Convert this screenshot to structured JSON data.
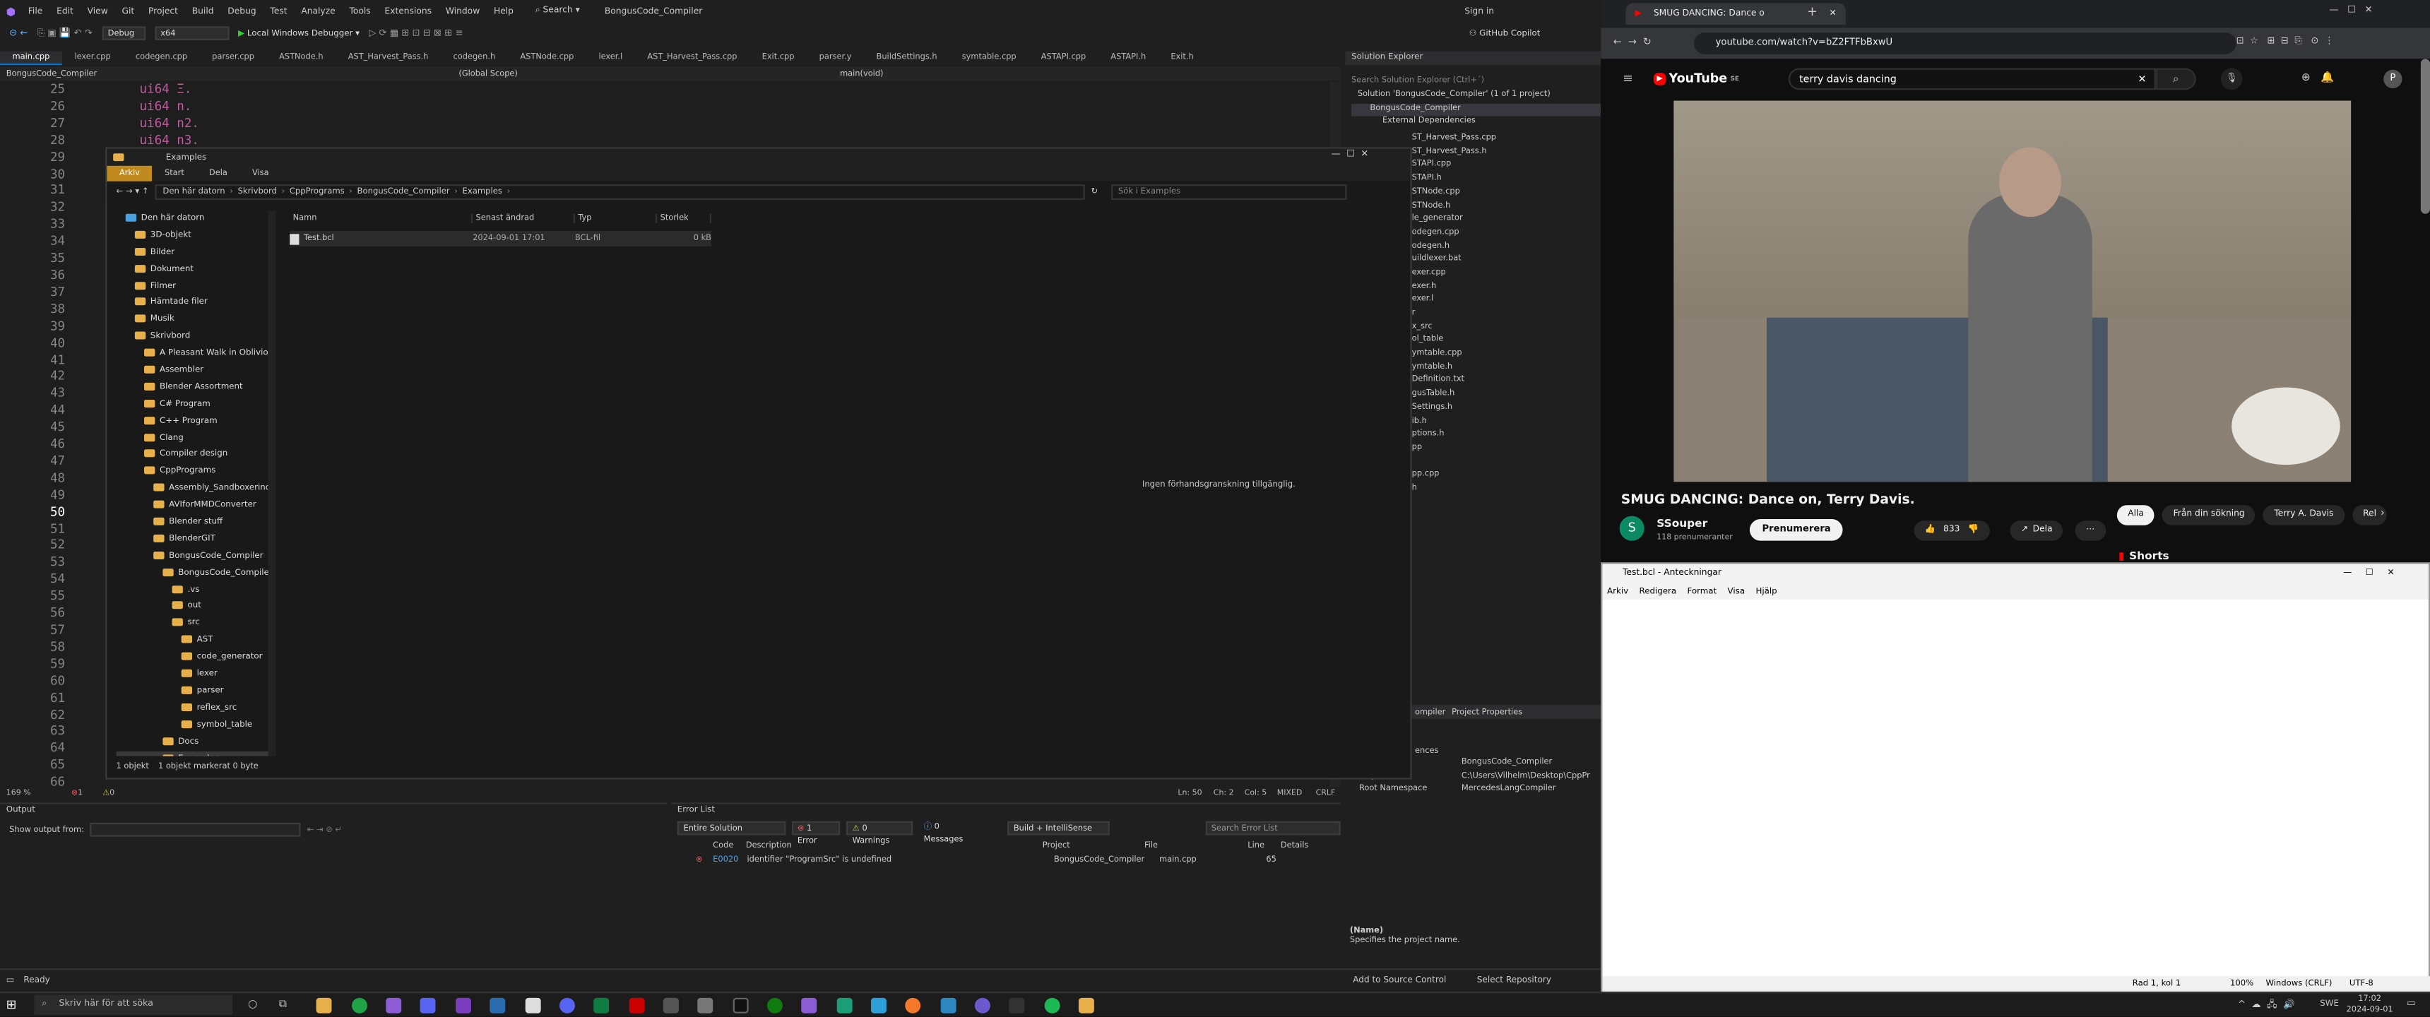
{
  "vs": {
    "menu": [
      "File",
      "Edit",
      "View",
      "Git",
      "Project",
      "Build",
      "Debug",
      "Test",
      "Analyze",
      "Tools",
      "Extensions",
      "Window",
      "Help"
    ],
    "search_label": "Search",
    "solution_title": "BongusCode_Compiler",
    "signin": "Sign in",
    "copilot": "GitHub Copilot",
    "config": "Debug",
    "platform": "x64",
    "debugger": "Local Windows Debugger",
    "tabs": [
      "main.cpp",
      "lexer.cpp",
      "codegen.cpp",
      "parser.cpp",
      "ASTNode.h",
      "AST_Harvest_Pass.h",
      "codegen.h",
      "ASTNode.cpp",
      "lexer.l",
      "AST_Harvest_Pass.cpp",
      "Exit.cpp",
      "parser.y",
      "BuildSettings.h",
      "symtable.cpp",
      "ASTAPI.cpp",
      "ASTAPI.h",
      "Exit.h"
    ],
    "scope_project": "BongusCode_Compiler",
    "scope_global": "(Global Scope)",
    "scope_fn": "main(void)",
    "line_numbers": [
      "25",
      "26",
      "27",
      "28",
      "29",
      "30",
      "31",
      "32",
      "33",
      "34",
      "35",
      "36",
      "37",
      "38",
      "39",
      "40",
      "41",
      "42",
      "43",
      "44",
      "45",
      "46",
      "47",
      "48",
      "49",
      "50",
      "51",
      "52",
      "53",
      "54",
      "55",
      "56",
      "57",
      "58",
      "59",
      "60",
      "61",
      "62",
      "63",
      "64",
      "65",
      "66"
    ],
    "code_lines": [
      "ui64 Ξ.",
      "ui64 n.",
      "ui64 n2.",
      "ui64 n3."
    ],
    "zoom": "169 %",
    "err_count": "1",
    "warn_count": "0",
    "ln": "Ln: 50",
    "ch": "Ch: 2",
    "col": "Col: 5",
    "mixed": "MIXED",
    "crlf": "CRLF",
    "status_ready": "Ready",
    "add_source": "Add to Source Control",
    "select_repo": "Select Repository",
    "output_title": "Output",
    "output_from": "Show output from:",
    "errorlist_title": "Error List",
    "errorlist_scope": "Entire Solution",
    "errors_btn": "1 Error",
    "warnings_btn": "0 Warnings",
    "messages_btn": "0 Messages",
    "build_filter": "Build + IntelliSense",
    "search_errors": "Search Error List",
    "err_headers": [
      "Code",
      "Description",
      "Project",
      "File",
      "Line",
      "Details"
    ],
    "err_row": {
      "code": "E0020",
      "desc": "identifier \"ProgramSrc\" is undefined",
      "project": "BongusCode_Compiler",
      "file": "main.cpp",
      "line": "65"
    },
    "sol_title": "Solution Explorer",
    "sol_search": "Search Solution Explorer (Ctrl+´)",
    "sol_items": [
      "Solution 'BongusCode_Compiler' (1 of 1 project)",
      "BongusCode_Compiler",
      "External Dependencies"
    ],
    "sol_files": [
      "ST_Harvest_Pass.cpp",
      "ST_Harvest_Pass.h",
      "STAPI.cpp",
      "STAPI.h",
      "STNode.cpp",
      "STNode.h",
      "le_generator",
      "odegen.cpp",
      "odegen.h",
      "uildlexer.bat",
      "exer.cpp",
      "exer.h",
      "exer.l",
      "r",
      "x_src",
      "ol_table",
      "ymtable.cpp",
      "ymtable.h",
      "Definition.txt",
      "gusTable.h",
      "Settings.h",
      "ib.h",
      "ptions.h",
      "pp",
      "",
      "pp.cpp",
      "h"
    ],
    "props_header_name": "ompiler",
    "props_header_kind": "Project Properties",
    "props_rows": [
      {
        "k": "",
        "v": "BongusCode_Compiler"
      },
      {
        "k": "Project File",
        "v": "C:\\Users\\Vilhelm\\Desktop\\CppPr"
      },
      {
        "k": "Root Namespace",
        "v": "MercedesLangCompiler"
      }
    ],
    "props_partial": "ences",
    "props_desc_title": "(Name)",
    "props_desc": "Specifies the project name."
  },
  "explorer": {
    "title": "Examples",
    "ribbon": [
      "Arkiv",
      "Start",
      "Dela",
      "Visa"
    ],
    "crumbs": [
      "Den här datorn",
      "Skrivbord",
      "CppPrograms",
      "BongusCode_Compiler",
      "Examples"
    ],
    "search_placeholder": "Sök i Examples",
    "columns": [
      "Namn",
      "Senast ändrad",
      "Typ",
      "Storlek"
    ],
    "files": [
      {
        "name": "Test.bcl",
        "date": "2024-09-01 17:01",
        "type": "BCL-fil",
        "size": "0 kB"
      }
    ],
    "preview": "Ingen förhandsgranskning tillgänglig.",
    "tree": [
      "Den här datorn",
      "3D-objekt",
      "Bilder",
      "Dokument",
      "Filmer",
      "Hämtade filer",
      "Musik",
      "Skrivbord",
      "A Pleasant Walk in Oblivion",
      "Assembler",
      "Blender Assortment",
      "C# Program",
      "C++ Program",
      "Clang",
      "Compiler design",
      "CppPrograms",
      "Assembly_Sandboxerino",
      "AVIforMMDConverter",
      "Blender stuff",
      "BlenderGIT",
      "BongusCode_Compiler",
      "BongusCode_Compiler",
      ".vs",
      "out",
      "src",
      "AST",
      "code_generator",
      "lexer",
      "parser",
      "reflex_src",
      "symbol_table",
      "Docs",
      "Examples"
    ],
    "status_count": "1 objekt",
    "status_selected": "1 objekt markerat  0 byte"
  },
  "browser": {
    "tab_title": "SMUG DANCING: Dance o",
    "url": "youtube.com/watch?v=bZ2FTFbBxwU",
    "logo": "YouTube",
    "logo_country": "SE",
    "search_query": "terry davis dancing",
    "avatar": "P",
    "video_title": "SMUG DANCING: Dance on, Terry Davis.",
    "channel": "SSouper",
    "subscribers": "118 prenumeranter",
    "subscribe": "Prenumerera",
    "likes": "833",
    "share": "Dela",
    "chips": [
      "Alla",
      "Från din sökning",
      "Terry A. Davis",
      "Rel"
    ],
    "shorts": "Shorts"
  },
  "notepad": {
    "title": "Test.bcl - Anteckningar",
    "menu": [
      "Arkiv",
      "Redigera",
      "Format",
      "Visa",
      "Hjälp"
    ],
    "pos": "Rad 1, kol 1",
    "zoom": "100%",
    "eol": "Windows (CRLF)",
    "enc": "UTF-8"
  },
  "taskbar": {
    "search": "Skriv här för att söka",
    "lang": "SWE",
    "time": "17:02",
    "date": "2024-09-01"
  }
}
